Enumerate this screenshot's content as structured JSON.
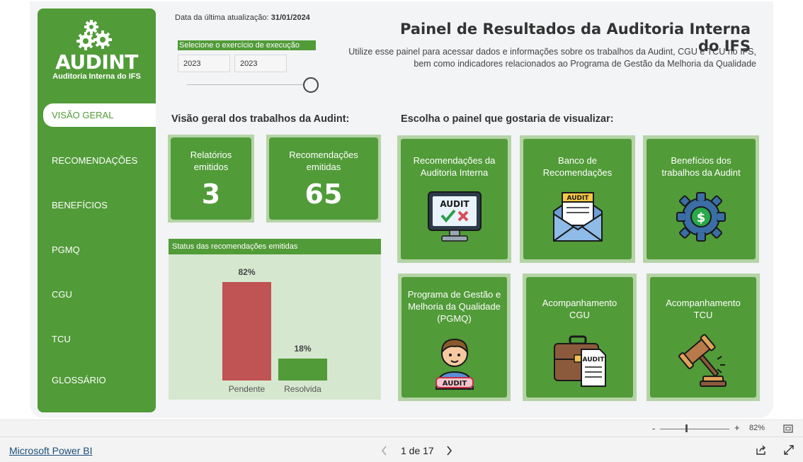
{
  "sidebar": {
    "logo_text": "AUDINT",
    "logo_subtitle": "Auditoria Interna do IFS",
    "items": [
      {
        "label": "VISÃO GERAL"
      },
      {
        "label": "RECOMENDAÇÕES"
      },
      {
        "label": "BENEFÍCIOS"
      },
      {
        "label": "PGMQ"
      },
      {
        "label": "CGU"
      },
      {
        "label": "TCU"
      },
      {
        "label": "GLOSSÁRIO"
      }
    ]
  },
  "header": {
    "update_label": "Data da última atualização:",
    "update_date": "31/01/2024",
    "slicer_title": "Selecione o exercício de execução",
    "year_from": "2023",
    "year_to": "2023",
    "title": "Painel de Resultados da Auditoria Interna do IFS",
    "subtitle_line1": "Utilize esse painel para acessar dados e informações sobre os trabalhos da Audint, CGU e TCU no IFS,",
    "subtitle_line2": "bem como indicadores relacionados ao Programa de Gestão da Melhoria da Qualidade"
  },
  "overview": {
    "title": "Visão geral dos trabalhos da Audint:",
    "kpis": [
      {
        "label_1": "Relatórios",
        "label_2": "emitidos",
        "value": "3"
      },
      {
        "label_1": "Recomendações",
        "label_2": "emitidas",
        "value": "65"
      }
    ]
  },
  "chart_data": {
    "type": "bar",
    "title": "Status das recomendações emitidas",
    "categories": [
      "Pendente",
      "Resolvida"
    ],
    "values": [
      82,
      18
    ],
    "value_labels": [
      "82%",
      "18%"
    ],
    "colors": [
      "#c05353",
      "#519b38"
    ],
    "ylim": [
      0,
      100
    ],
    "grid": false
  },
  "panels": {
    "title": "Escolha o painel que gostaria de visualizar:",
    "tiles": [
      {
        "line1": "Recomendações da",
        "line2": "Auditoria Interna",
        "line3": "",
        "icon": "audit-monitor-icon",
        "icon_text": "AUDIT"
      },
      {
        "line1": "Banco de",
        "line2": "Recomendações",
        "line3": "",
        "icon": "audit-envelope-icon",
        "icon_text": "AUDIT"
      },
      {
        "line1": "Benefícios dos",
        "line2": "trabalhos da Audint",
        "line3": "",
        "icon": "dollar-gear-icon",
        "icon_text": "$"
      },
      {
        "line1": "Programa de Gestão e",
        "line2": "Melhoria da Qualidade",
        "line3": "(PGMQ)",
        "icon": "auditor-person-icon",
        "icon_text": "AUDIT"
      },
      {
        "line1": "Acompanhamento",
        "line2": "CGU",
        "line3": "",
        "icon": "audit-briefcase-icon",
        "icon_text": "AUDIT"
      },
      {
        "line1": "Acompanhamento",
        "line2": "TCU",
        "line3": "",
        "icon": "gavel-icon",
        "icon_text": ""
      }
    ]
  },
  "zoom": {
    "minus": "-",
    "plus": "+",
    "level": "82%"
  },
  "footer": {
    "brand": "Microsoft Power BI",
    "page_indicator": "1 de 17"
  },
  "colors": {
    "green": "#519b38",
    "light_green": "#b5d4a6",
    "chart_bg": "#d6e7cf",
    "pending_red": "#c05353"
  }
}
